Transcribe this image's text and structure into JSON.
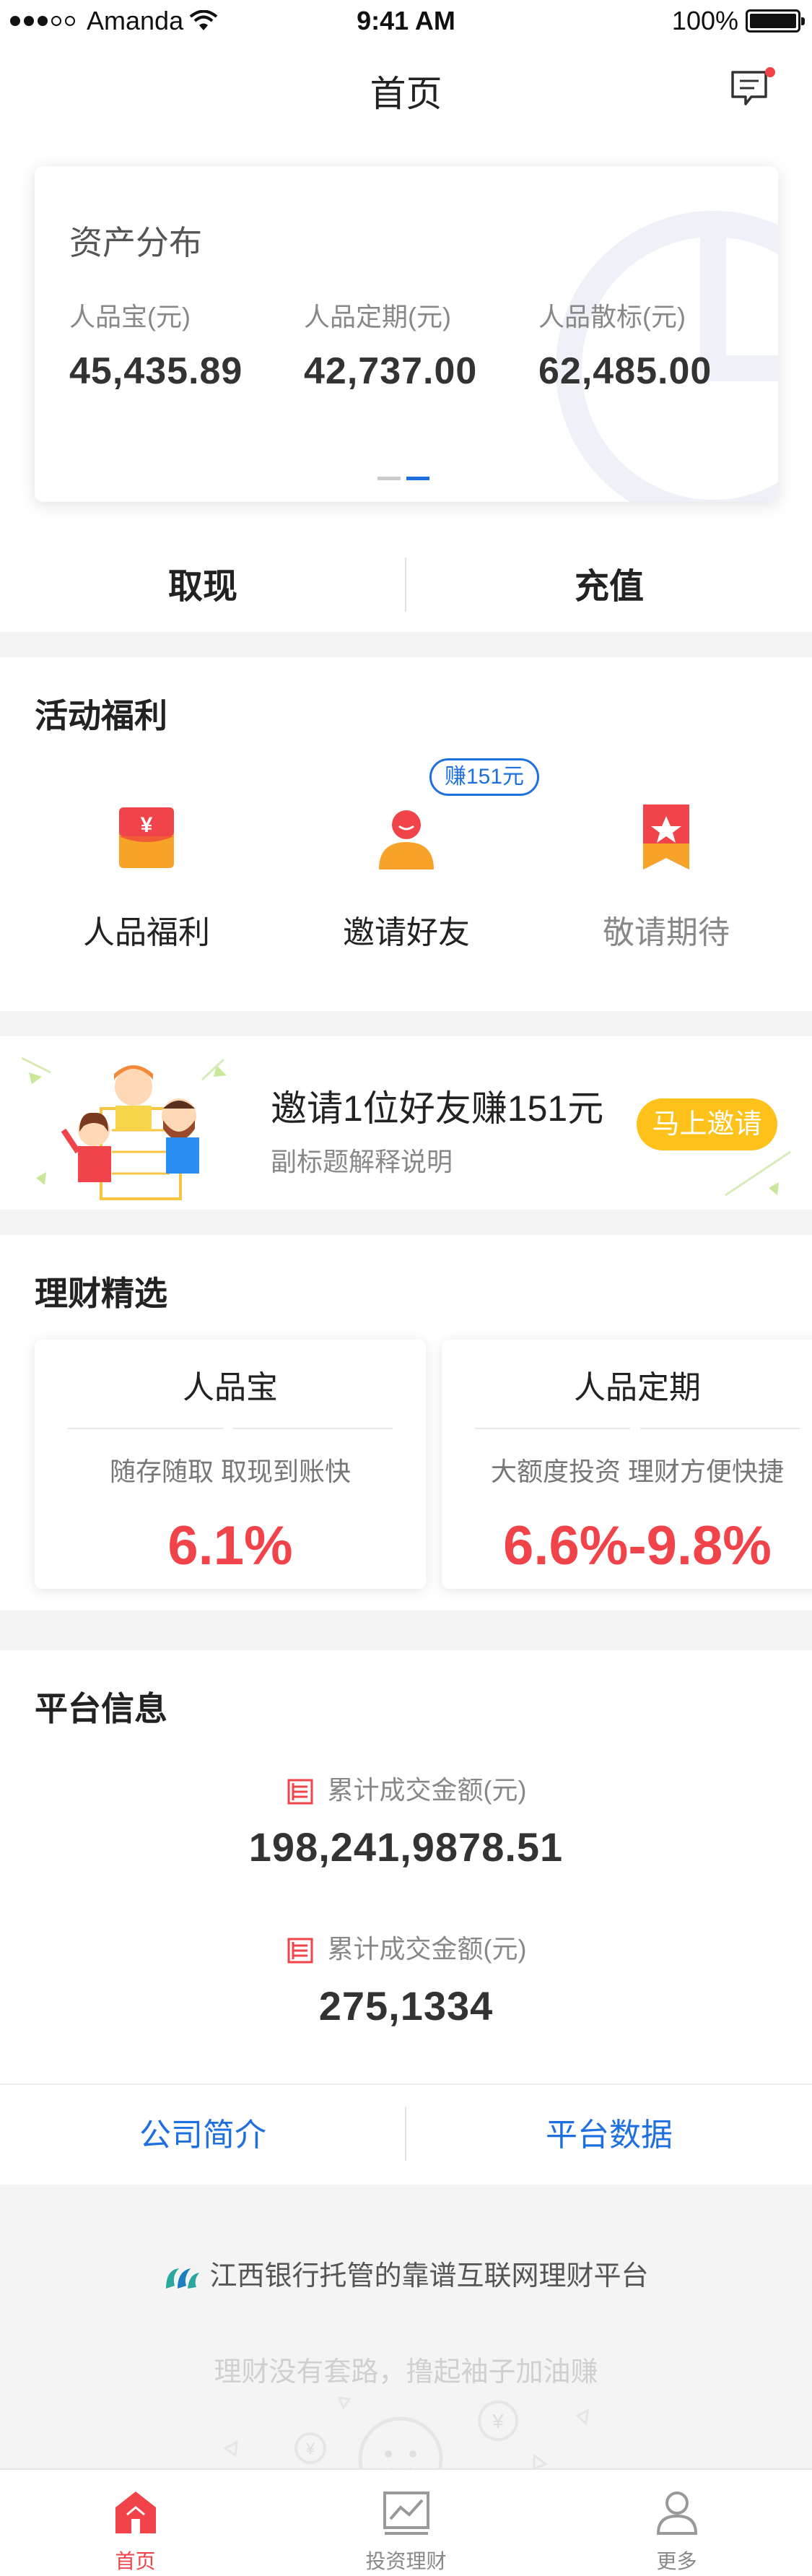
{
  "status_bar": {
    "carrier": "Amanda",
    "time": "9:41 AM",
    "battery": "100%"
  },
  "nav": {
    "title": "首页",
    "message_icon": "message-icon"
  },
  "assets": {
    "title": "资产分布",
    "items": [
      {
        "label": "人品宝(元)",
        "value": "45,435.89"
      },
      {
        "label": "人品定期(元)",
        "value": "42,737.00"
      },
      {
        "label": "人品散标(元)",
        "value": "62,485.00"
      }
    ]
  },
  "actions": {
    "withdraw": "取现",
    "recharge": "充值"
  },
  "welfare": {
    "title": "活动福利",
    "items": [
      {
        "label": "人品福利",
        "icon": "red-packet-icon"
      },
      {
        "label": "邀请好友",
        "icon": "invite-friend-icon",
        "badge": "赚151元"
      },
      {
        "label": "敬请期待",
        "icon": "star-ribbon-icon"
      }
    ]
  },
  "banner": {
    "title": "邀请1位好友赚151元",
    "subtitle": "副标题解释说明",
    "button": "马上邀请"
  },
  "products": {
    "title": "理财精选",
    "items": [
      {
        "name": "人品宝",
        "desc": "随存随取 取现到账快",
        "rate": "6.1%"
      },
      {
        "name": "人品定期",
        "desc": "大额度投资 理财方便快捷",
        "rate": "6.6%-9.8%"
      }
    ]
  },
  "platform": {
    "title": "平台信息",
    "stats": [
      {
        "label": "累计成交金额(元)",
        "value": "198,241,9878.51"
      },
      {
        "label": "累计成交金额(元)",
        "value": "275,1334"
      }
    ],
    "links": {
      "about": "公司简介",
      "data": "平台数据"
    }
  },
  "footer": {
    "brand": "江西银行托管的靠谱互联网理财平台",
    "slogan": "理财没有套路，撸起袖子加油赚"
  },
  "tabs": [
    {
      "label": "首页",
      "icon": "home-icon",
      "active": true
    },
    {
      "label": "投资理财",
      "icon": "chart-icon",
      "active": false
    },
    {
      "label": "更多",
      "icon": "user-icon",
      "active": false
    }
  ],
  "colors": {
    "accent_red": "#f0444a",
    "link_blue": "#1e6fe0",
    "badge_yellow": "#ffc21a"
  }
}
